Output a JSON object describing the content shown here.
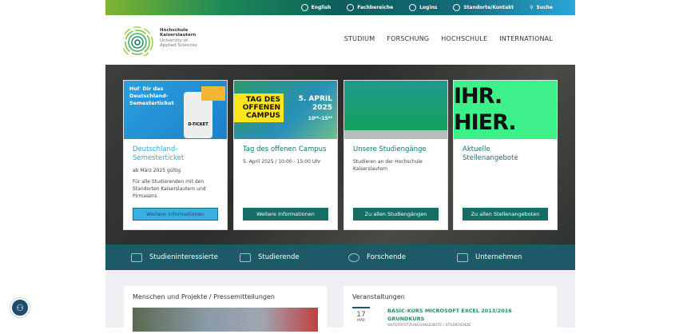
{
  "topbar": {
    "items": [
      {
        "label": "English",
        "icon": "globe-icon"
      },
      {
        "label": "Fachbereiche",
        "icon": "compass-icon"
      },
      {
        "label": "Logins",
        "icon": "user-icon"
      },
      {
        "label": "Standorte/Kontakt",
        "icon": "location-icon"
      },
      {
        "label": "Suche",
        "icon": "search-icon"
      }
    ]
  },
  "logo": {
    "line1": "Hochschule",
    "line2": "Kaiserslautern",
    "line3": "University of",
    "line4": "Applied Sciences"
  },
  "nav": [
    "STUDIUM",
    "FORSCHUNG",
    "HOCHSCHULE",
    "INTERNATIONAL"
  ],
  "cards": [
    {
      "img_text": "Hol' Dir das Deutschland-Semesterticket",
      "img_badge": "D-TICKET",
      "title": "Deutschland-Semesterticket",
      "sub": "ab März 2025 gültig",
      "text": "Für alle Studierenden mit den Standorten Kaiserslautern und Pirmasens",
      "button": "Weitere Informationen"
    },
    {
      "img_text": "TAG DES OFFENEN CAMPUS",
      "img_date": "5. APRIL 2025",
      "img_time": "10⁰⁰–15⁰⁰",
      "title": "Tag des offenen Campus",
      "sub": "5. April 2025 / 10:00 - 15:00 Uhr",
      "button": "Weitere Informationen"
    },
    {
      "title": "Unsere Studiengänge",
      "sub": "Studieren an der Hochschule Kaiserslautern",
      "button": "Zu allen Studiengängen"
    },
    {
      "img_text": "IHR. HIER.",
      "title": "Aktuelle Stellenangebote",
      "button": "Zu allen Stellenangeboten"
    }
  ],
  "band": [
    "Studieninteressierte",
    "Studierende",
    "Forschende",
    "Unternehmen"
  ],
  "news": {
    "title": "Menschen und Projekte / Pressemitteilungen"
  },
  "events": {
    "title": "Veranstaltungen",
    "items": [
      {
        "day": "17",
        "month": "MÄR",
        "title": "BASIC-KURS MICROSOFT EXCEL 2013/2016 GRUNDKURS",
        "category": "UNTERSTÜTZUNGSANGEBOTE / STUDIERENDE"
      }
    ]
  }
}
